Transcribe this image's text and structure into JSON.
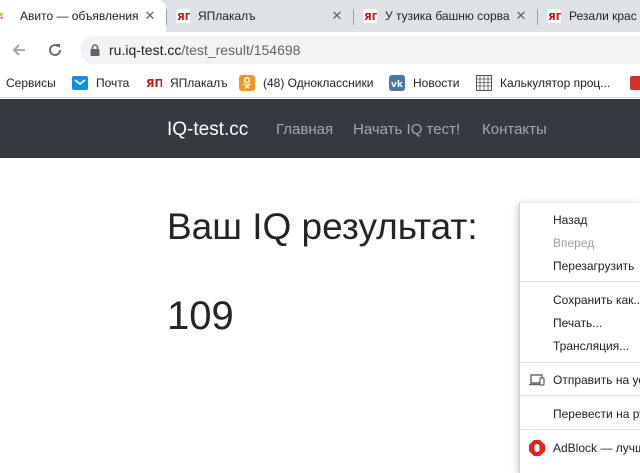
{
  "tabs": [
    {
      "title": "Авито — объявления о",
      "active": true,
      "close": "✕"
    },
    {
      "title": "ЯПлакалъ",
      "active": false,
      "close": "✕"
    },
    {
      "title": "У тузика башню сорва",
      "active": false,
      "close": "✕"
    },
    {
      "title": "Резали крас",
      "active": false,
      "close": ""
    }
  ],
  "toolbar": {
    "back_icon": "arrow-left-icon",
    "forward_icon": "arrow-right-icon",
    "reload_icon": "reload-icon",
    "url_domain": "ru.iq-test.cc",
    "url_path": "/test_result/154698"
  },
  "bookmarks": [
    {
      "label": "Сервисы"
    },
    {
      "label": "Почта"
    },
    {
      "label": "ЯПлакалъ"
    },
    {
      "label": "(48) Одноклассники"
    },
    {
      "label": "Новости"
    },
    {
      "label": "Калькулятор проц..."
    }
  ],
  "site": {
    "brand": "IQ-test.cc",
    "nav": [
      "Главная",
      "Начать IQ тест!",
      "Контакты"
    ]
  },
  "result": {
    "heading": "Ваш IQ результат:",
    "value": "109"
  },
  "context_menu": {
    "items": [
      {
        "label": "Назад",
        "disabled": false
      },
      {
        "label": "Вперед",
        "disabled": true
      },
      {
        "label": "Перезагрузить",
        "disabled": false
      },
      {
        "label": "Сохранить как...",
        "disabled": false
      },
      {
        "label": "Печать...",
        "disabled": false
      },
      {
        "label": "Трансляция...",
        "disabled": false
      },
      {
        "label": "Отправить на уст",
        "disabled": false,
        "icon": "send-to-device-icon"
      },
      {
        "label": "Перевести на русский",
        "disabled": false
      },
      {
        "label": "AdBlock — лучший",
        "disabled": false,
        "icon": "adblock-icon"
      }
    ]
  },
  "colors": {
    "tab_strip": "#dee1e6",
    "site_nav_bg": "#343a40",
    "text": "#212529",
    "adblock_red": "#e5211d"
  }
}
